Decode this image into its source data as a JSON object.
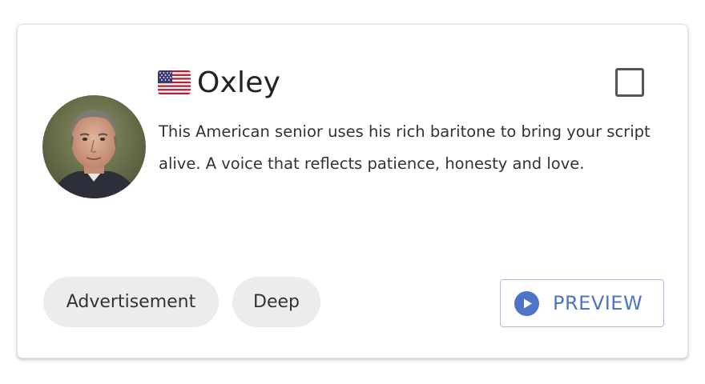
{
  "voice": {
    "name": "Oxley",
    "flag_icon": "us-flag-icon",
    "description": "This American senior uses his rich baritone to bring your script alive. A voice that reflects patience, honesty and love.",
    "selected": false
  },
  "tags": [
    {
      "label": "Advertisement"
    },
    {
      "label": "Deep"
    }
  ],
  "preview": {
    "label": "PREVIEW",
    "icon": "play-icon"
  },
  "colors": {
    "accent": "#4d74c7",
    "tag_background": "#ececec",
    "preview_border": "#a9bedf"
  }
}
